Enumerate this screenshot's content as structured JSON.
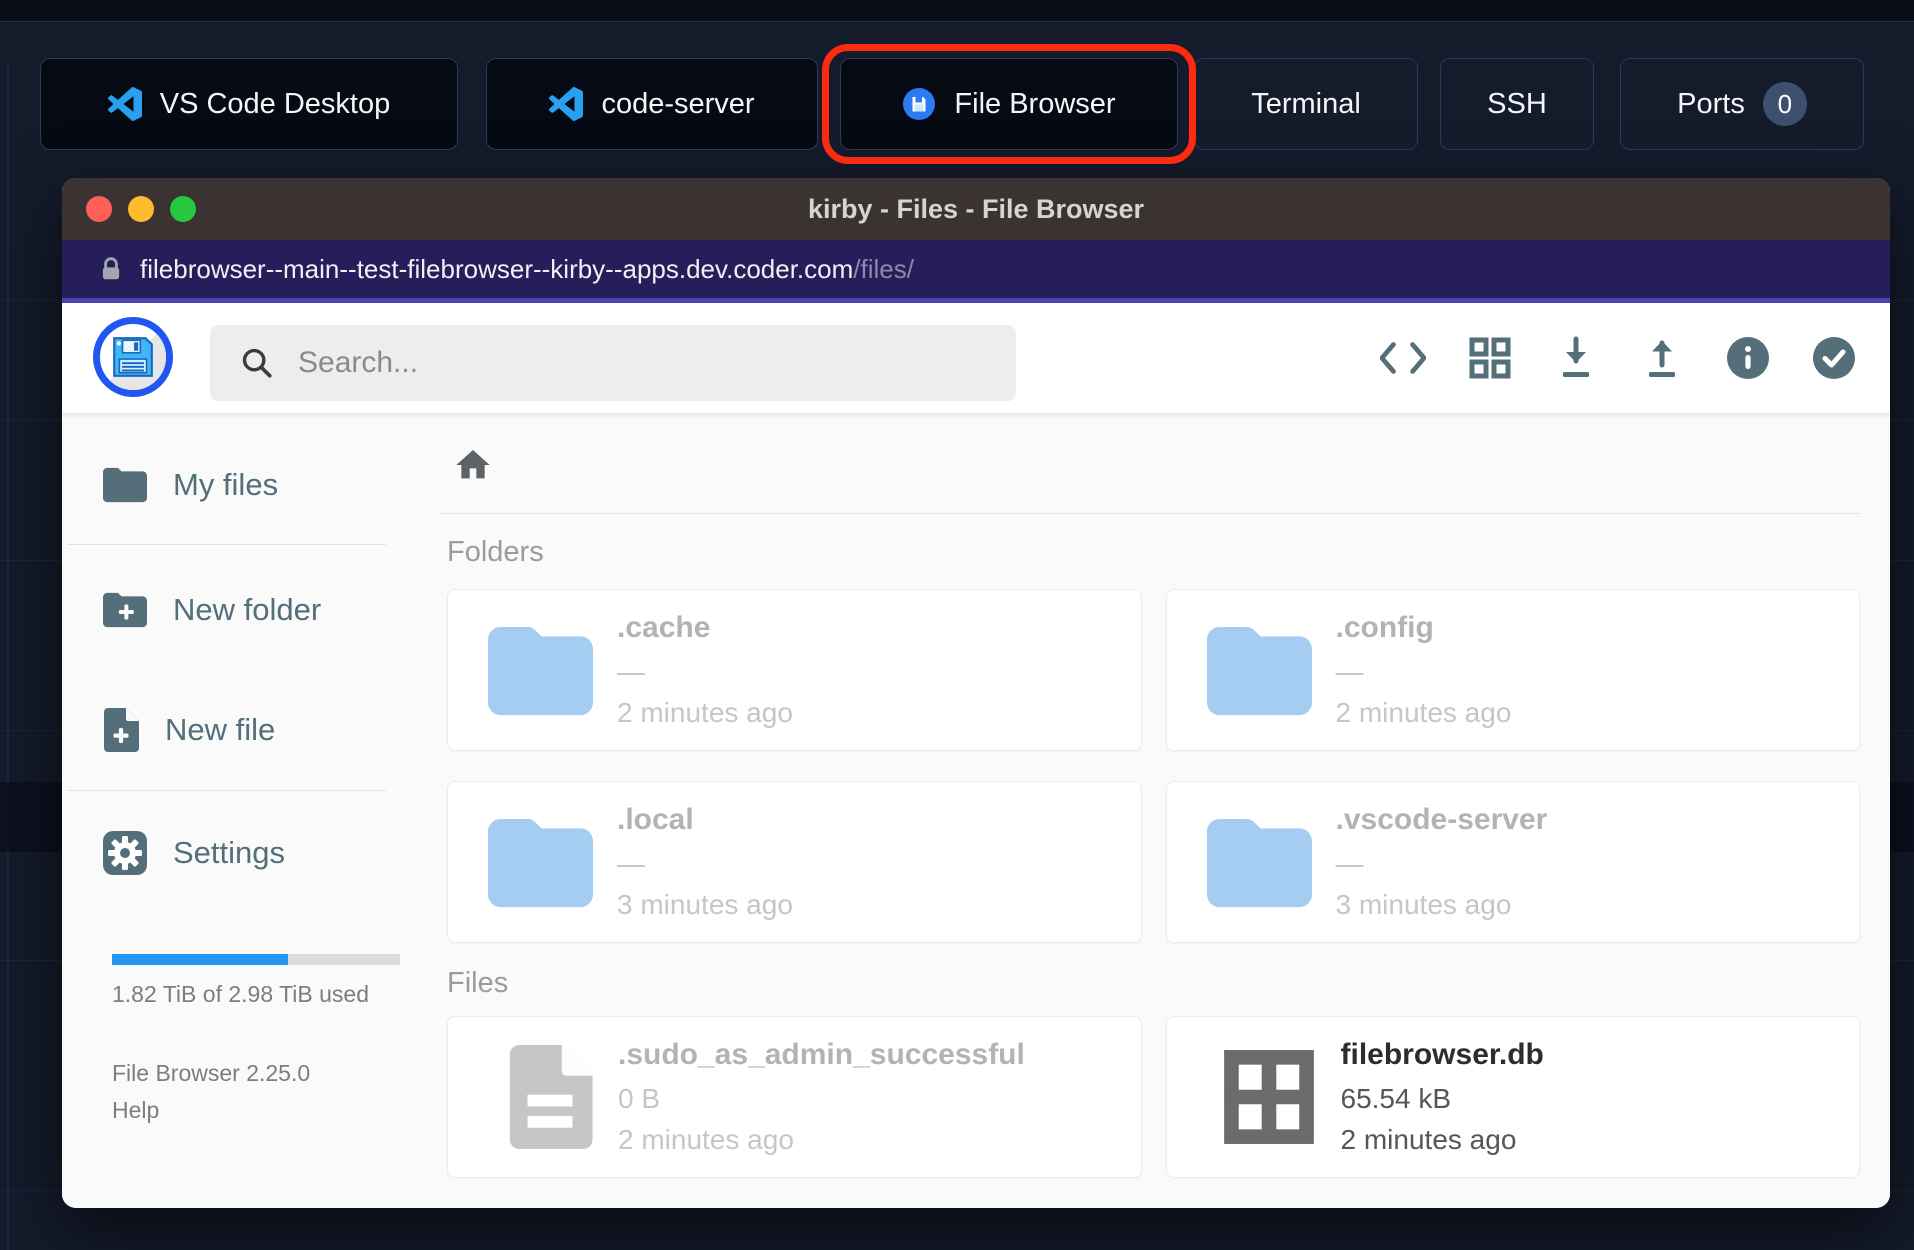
{
  "topbar": {
    "apps": [
      {
        "label": "VS Code Desktop"
      },
      {
        "label": "code-server"
      },
      {
        "label": "File Browser"
      },
      {
        "label": "Terminal"
      },
      {
        "label": "SSH"
      },
      {
        "label": "Ports",
        "badge": "0"
      }
    ]
  },
  "window": {
    "title": "kirby - Files - File Browser",
    "url": {
      "host": "filebrowser--main--test-filebrowser--kirby--apps.dev.coder.com",
      "path": "/files/"
    },
    "toolbar": {
      "search_placeholder": "Search...",
      "icons": [
        "code",
        "grid-view",
        "download",
        "upload",
        "info",
        "check"
      ]
    },
    "sidebar": {
      "items": [
        {
          "label": "My files"
        },
        {
          "label": "New folder"
        },
        {
          "label": "New file"
        },
        {
          "label": "Settings"
        }
      ],
      "usage": {
        "text": "1.82 TiB of 2.98 TiB used",
        "percent": 61
      },
      "version": "File Browser 2.25.0",
      "help_label": "Help"
    },
    "content": {
      "folders_label": "Folders",
      "files_label": "Files",
      "folders": [
        {
          "name": ".cache",
          "size": "—",
          "time": "2 minutes ago"
        },
        {
          "name": ".config",
          "size": "—",
          "time": "2 minutes ago"
        },
        {
          "name": ".local",
          "size": "—",
          "time": "3 minutes ago"
        },
        {
          "name": ".vscode-server",
          "size": "—",
          "time": "3 minutes ago"
        }
      ],
      "files": [
        {
          "name": ".sudo_as_admin_successful",
          "size": "0 B",
          "time": "2 minutes ago"
        },
        {
          "name": "filebrowser.db",
          "size": "65.54 kB",
          "time": "2 minutes ago"
        }
      ]
    }
  },
  "colors": {
    "highlight_red": "#fb2b12",
    "progress_blue": "#2196f3",
    "folder_blue": "#a5cdf2",
    "logo_blue": "#2156f0"
  }
}
